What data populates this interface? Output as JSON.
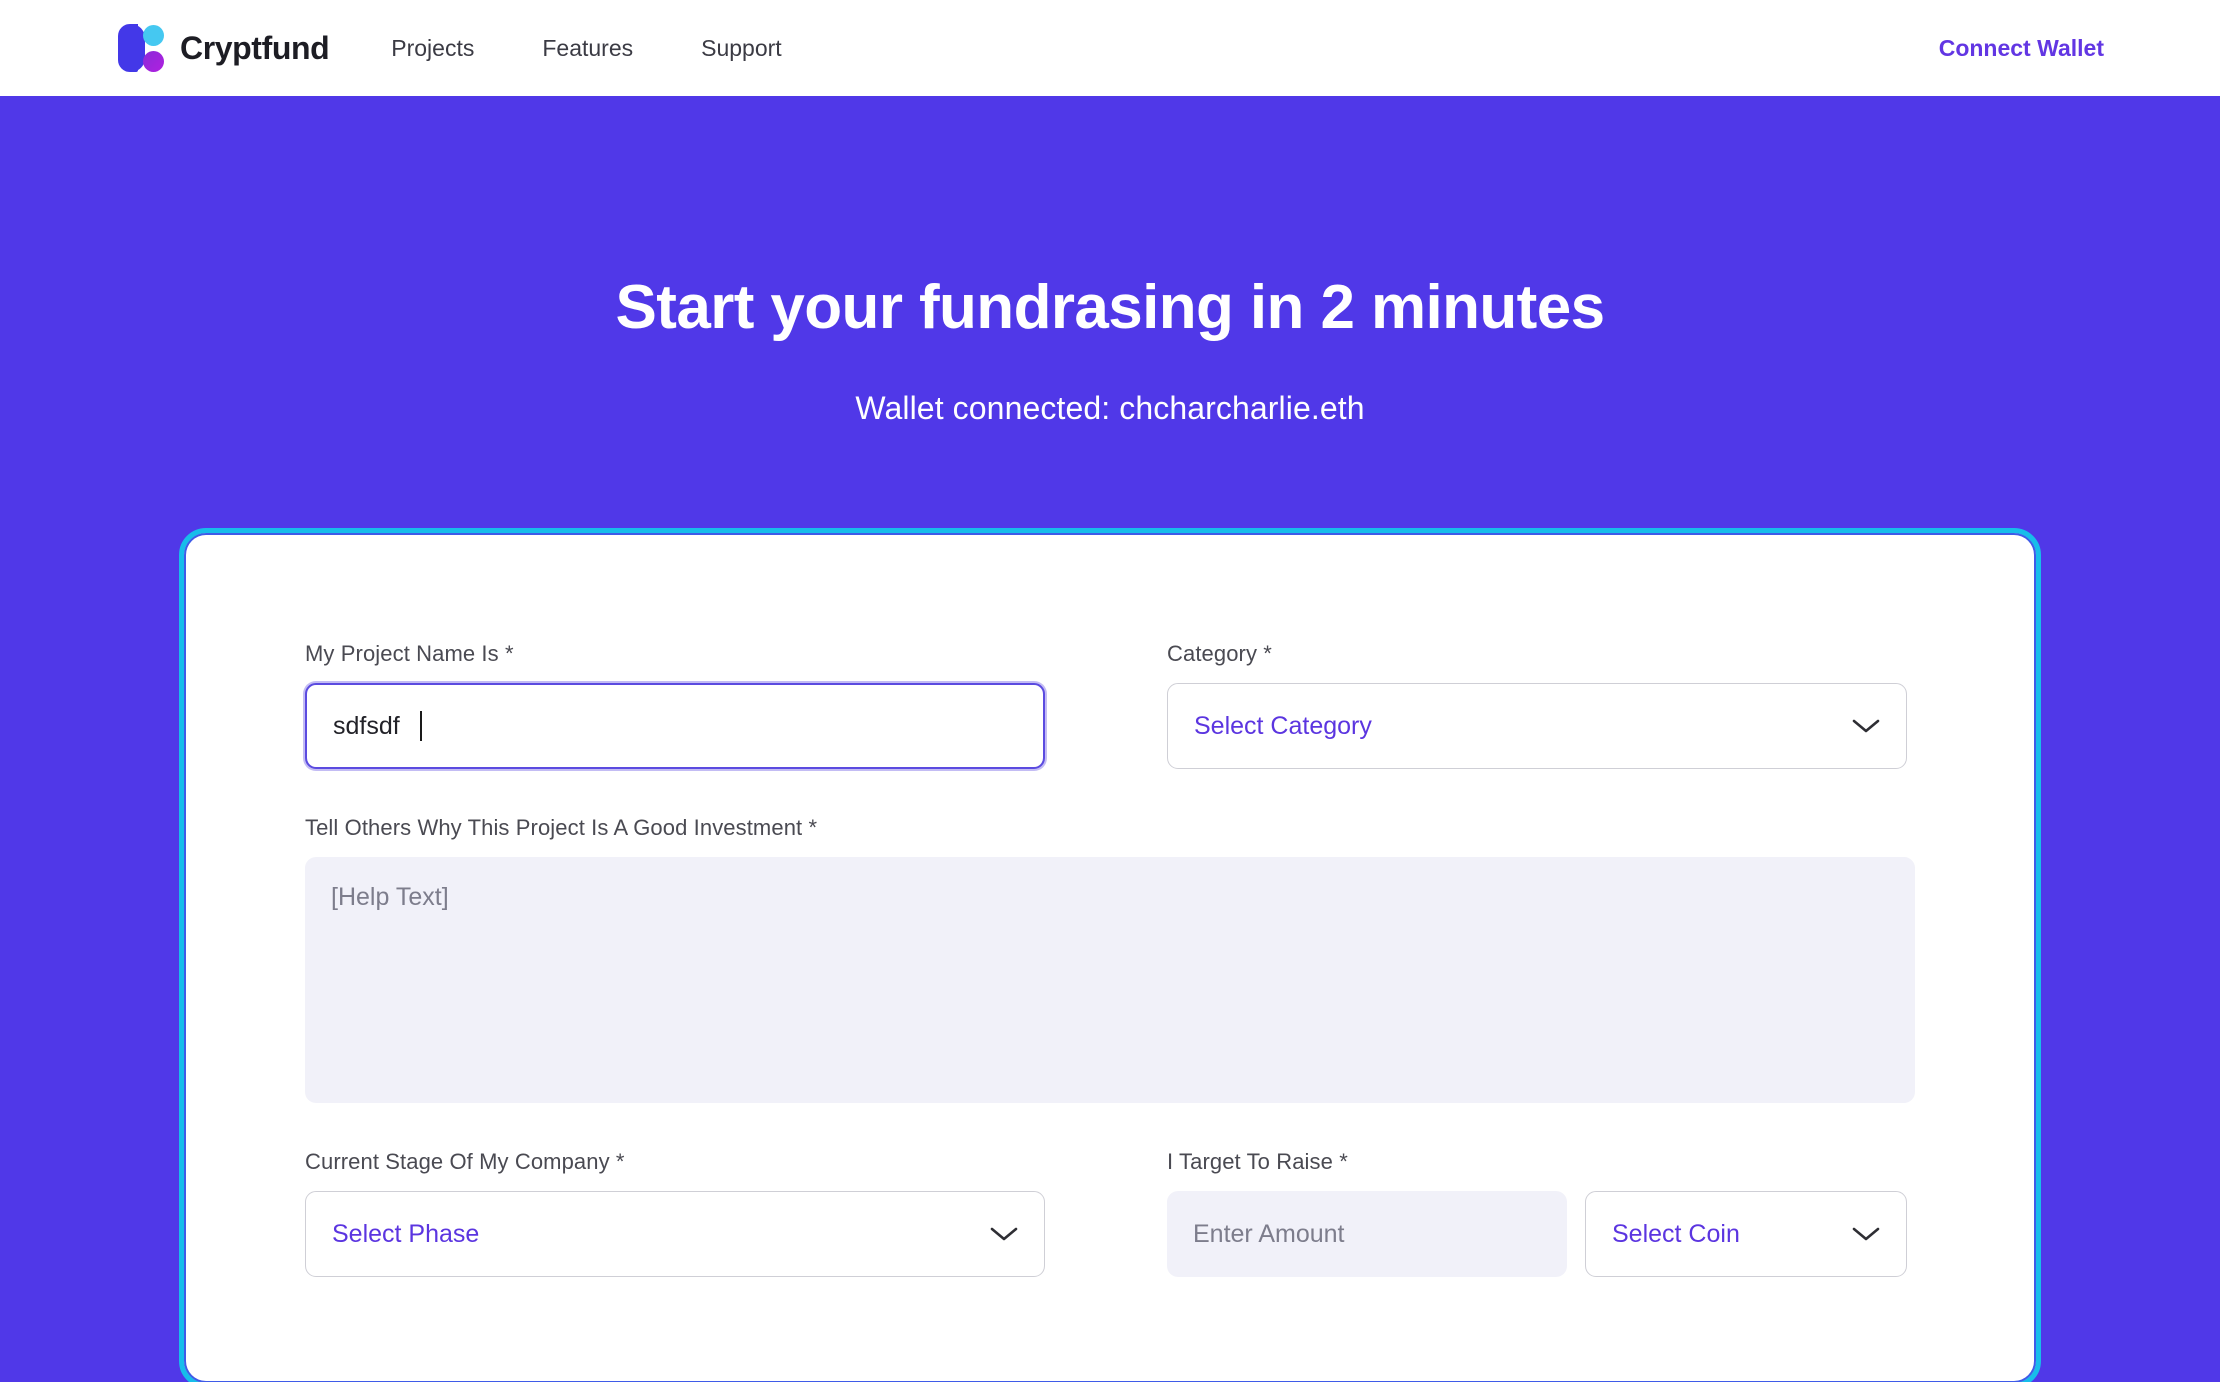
{
  "header": {
    "brand_name": "Cryptfund",
    "logo_icon": "cryptfund-logo-icon",
    "nav": [
      {
        "label": "Projects"
      },
      {
        "label": "Features"
      },
      {
        "label": "Support"
      }
    ],
    "connect_wallet_label": "Connect Wallet"
  },
  "hero": {
    "title": "Start your fundrasing in 2 minutes",
    "subtitle": "Wallet connected: chcharcharlie.eth",
    "background_color": "#5038E8"
  },
  "form": {
    "card_border_color": "#17BDEA",
    "card_inner_border_color": "#3F5BE8",
    "required_marker": "*",
    "project_name": {
      "label": "My Project Name Is *",
      "value": "sdfsdf",
      "placeholder": ""
    },
    "category": {
      "label": "Category *",
      "value": "Select Category",
      "chevron_icon": "chevron-down-icon"
    },
    "description": {
      "label": "Tell Others Why This Project Is A Good Investment *",
      "value": "",
      "placeholder": "[Help Text]"
    },
    "stage": {
      "label": "Current Stage Of My Company *",
      "value": "Select Phase",
      "chevron_icon": "chevron-down-icon"
    },
    "target_raise": {
      "label": "I Target To Raise *",
      "amount_value": "",
      "amount_placeholder": "Enter Amount",
      "coin_value": "Select Coin",
      "chevron_icon": "chevron-down-icon"
    }
  }
}
